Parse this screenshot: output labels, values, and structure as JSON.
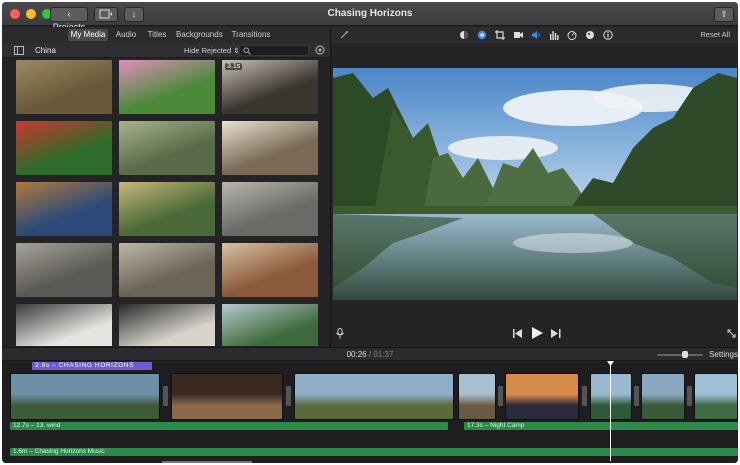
{
  "window": {
    "title": "Chasing Horizons"
  },
  "toolbar": {
    "projects_label": "Projects"
  },
  "browser": {
    "tabs": [
      "My Media",
      "Audio",
      "Titles",
      "Backgrounds",
      "Transitions"
    ],
    "active_tab": "My Media",
    "library_name": "China",
    "filter_label": "Hide Rejected",
    "clips": [
      {
        "name": "license-plate",
        "duration": "",
        "c1": "#6b5a3a",
        "c2": "#9c8a62"
      },
      {
        "name": "pink-flower",
        "duration": "",
        "c1": "#4c8a3a",
        "c2": "#e28fbf"
      },
      {
        "name": "steaming-pot",
        "duration": "3.1s",
        "c1": "#3b3530",
        "c2": "#c9c0b3"
      },
      {
        "name": "red-chilies",
        "duration": "",
        "c1": "#2f6b2b",
        "c2": "#c9382c"
      },
      {
        "name": "vegetables",
        "duration": "",
        "c1": "#5a6b4a",
        "c2": "#a8b48a"
      },
      {
        "name": "eggs-basket",
        "duration": "",
        "c1": "#7a6a55",
        "c2": "#e8e2d0"
      },
      {
        "name": "hands-fruit",
        "duration": "",
        "c1": "#2d4a7a",
        "c2": "#b07a3a"
      },
      {
        "name": "market-stall",
        "duration": "",
        "c1": "#4a6a3a",
        "c2": "#c7b77a"
      },
      {
        "name": "scooter-street",
        "duration": "",
        "c1": "#6a6a66",
        "c2": "#b9b6ad"
      },
      {
        "name": "village-road",
        "duration": "",
        "c1": "#5c5a54",
        "c2": "#a5a39a"
      },
      {
        "name": "old-wall",
        "duration": "",
        "c1": "#6b6558",
        "c2": "#c0b8a6"
      },
      {
        "name": "street-vendor",
        "duration": "",
        "c1": "#8a5a3a",
        "c2": "#d8c2a2"
      },
      {
        "name": "calligraphy-1",
        "duration": "",
        "c1": "#e6e4e0",
        "c2": "#3a3a3a"
      },
      {
        "name": "calligraphy-2",
        "duration": "",
        "c1": "#d8d4cc",
        "c2": "#2a2a2a"
      },
      {
        "name": "river-trees",
        "duration": "",
        "c1": "#3d6a3a",
        "c2": "#b8c8d0"
      }
    ]
  },
  "viewer": {
    "reset_label": "Reset All"
  },
  "timeline": {
    "timecode_current": "00:26",
    "timecode_separator": "/",
    "timecode_total": "01:37",
    "settings_label": "Settings",
    "title_clip": "2.9s – CHASING HORIZONS",
    "audio_clips": [
      {
        "label": "12.7s – 13. wind"
      },
      {
        "label": "17.3s – Night Camp"
      },
      {
        "label": "1.6m – Chasing Horizons Music"
      }
    ],
    "video_clips": [
      {
        "name": "clip-karst-1",
        "c1": "#6d8fa8",
        "c2": "#3e5a3a"
      },
      {
        "name": "clip-restaurant",
        "c1": "#3a2a22",
        "c2": "#8a6a4a"
      },
      {
        "name": "clip-village",
        "c1": "#8fb0c8",
        "c2": "#5a6a3a"
      },
      {
        "name": "clip-houses",
        "c1": "#a8c0d0",
        "c2": "#6a5a44"
      },
      {
        "name": "clip-sunset",
        "c1": "#d88a4a",
        "c2": "#2a2a3a"
      },
      {
        "name": "clip-river-1",
        "c1": "#9ab8d0",
        "c2": "#2e5a3a"
      },
      {
        "name": "clip-river-2",
        "c1": "#8aa8c0",
        "c2": "#3a5a3a"
      },
      {
        "name": "clip-river-3",
        "c1": "#a0c0d8",
        "c2": "#3e6a44"
      }
    ]
  },
  "colors": {
    "accent": "#6d5bd0",
    "audio": "#2d8a4a",
    "highlight": "#3a8ff0"
  }
}
